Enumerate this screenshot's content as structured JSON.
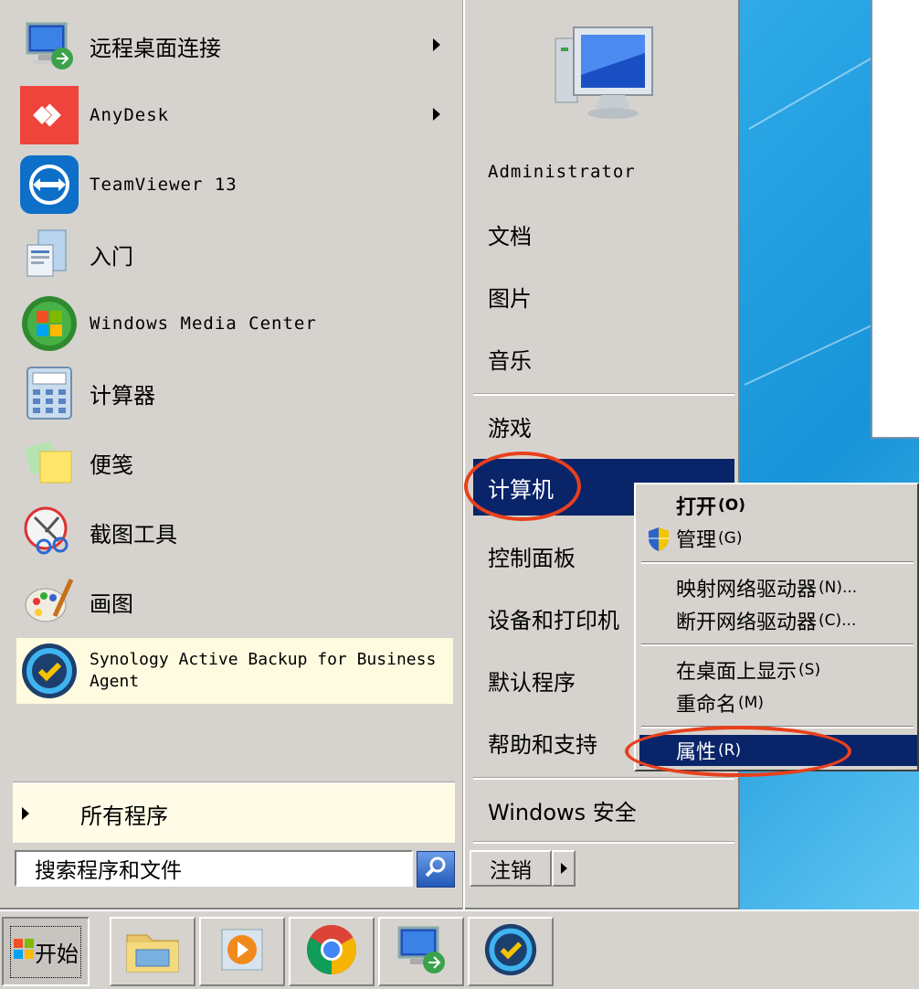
{
  "start_menu": {
    "programs": [
      {
        "label": "远程桌面连接",
        "icon": "remote-desktop-icon",
        "has_submenu": true
      },
      {
        "label": "AnyDesk",
        "icon": "anydesk-icon",
        "has_submenu": true
      },
      {
        "label": "TeamViewer 13",
        "icon": "teamviewer-icon",
        "has_submenu": false
      },
      {
        "label": "入门",
        "icon": "getting-started-icon",
        "has_submenu": false
      },
      {
        "label": "Windows Media Center",
        "icon": "windows-media-center-icon",
        "has_submenu": false
      },
      {
        "label": "计算器",
        "icon": "calculator-icon",
        "has_submenu": false
      },
      {
        "label": "便笺",
        "icon": "sticky-notes-icon",
        "has_submenu": false
      },
      {
        "label": "截图工具",
        "icon": "snipping-tool-icon",
        "has_submenu": false
      },
      {
        "label": "画图",
        "icon": "paint-icon",
        "has_submenu": false
      },
      {
        "label": "Synology Active Backup for Business Agent",
        "icon": "synology-backup-icon",
        "has_submenu": false
      }
    ],
    "all_programs": "所有程序",
    "search_placeholder": "搜索程序和文件",
    "right_items": {
      "user": "Administrator",
      "documents": "文档",
      "pictures": "图片",
      "music": "音乐",
      "games": "游戏",
      "computer": "计算机",
      "control_panel": "控制面板",
      "devices_printers": "设备和打印机",
      "default_programs": "默认程序",
      "help_support": "帮助和支持",
      "windows_security": "Windows 安全"
    },
    "logoff": "注销"
  },
  "context_menu": {
    "open": {
      "label": "打开",
      "accel": "(O)"
    },
    "manage": {
      "label": "管理",
      "accel": "(G)"
    },
    "map_drive": {
      "label": "映射网络驱动器",
      "accel": "(N)..."
    },
    "disconnect_drive": {
      "label": "断开网络驱动器",
      "accel": "(C)..."
    },
    "show_desktop": {
      "label": "在桌面上显示",
      "accel": "(S)"
    },
    "rename": {
      "label": "重命名",
      "accel": "(M)"
    },
    "properties": {
      "label": "属性",
      "accel": "(R)"
    }
  },
  "taskbar": {
    "start_label": "开始",
    "buttons": [
      {
        "icon": "file-explorer-icon"
      },
      {
        "icon": "media-player-icon"
      },
      {
        "icon": "chrome-icon"
      },
      {
        "icon": "remote-desktop-icon"
      },
      {
        "icon": "synology-backup-icon"
      }
    ]
  },
  "colors": {
    "menu_bg": "#d6d3ce",
    "highlight": "#0a246a",
    "annotation": "#e8401c",
    "desktop": "#2aa9e8"
  }
}
